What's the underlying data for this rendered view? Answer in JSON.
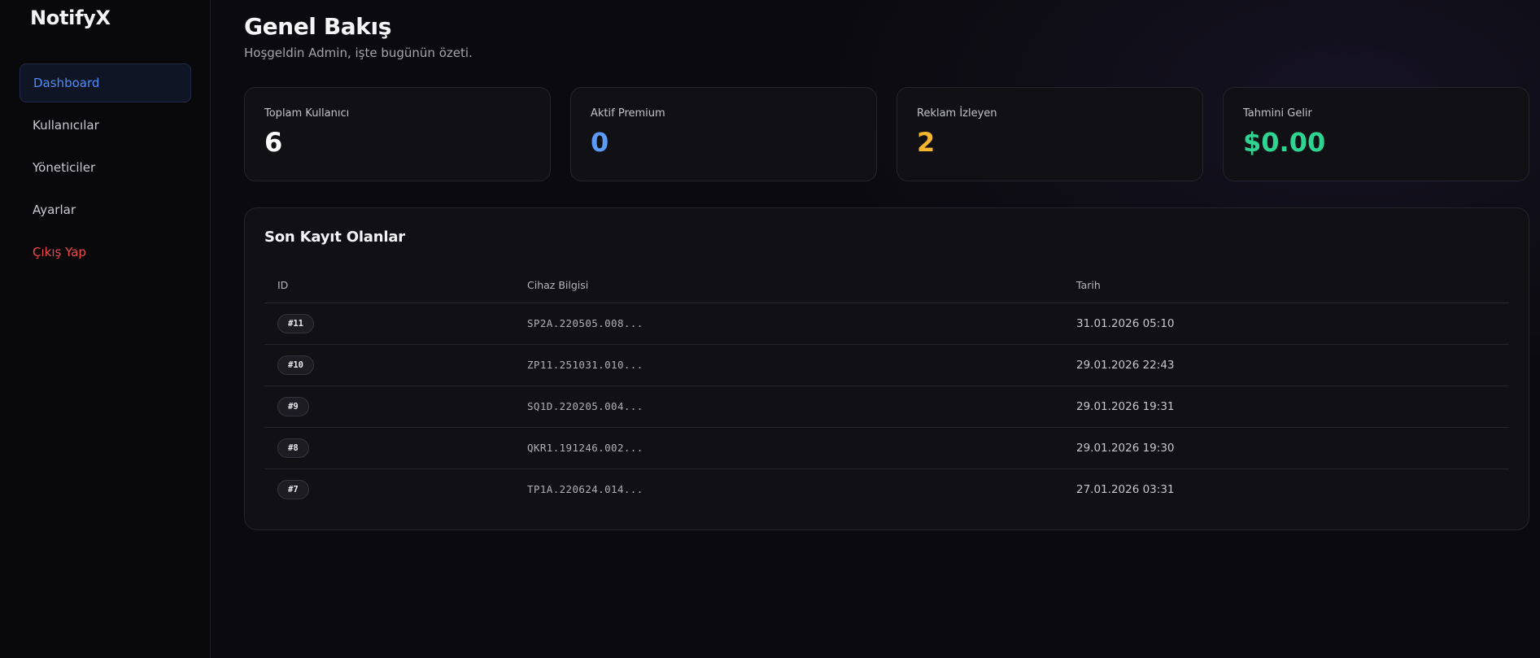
{
  "brand": "NotifyX",
  "nav": {
    "items": [
      {
        "label": "Dashboard"
      },
      {
        "label": "Kullanıcılar"
      },
      {
        "label": "Yöneticiler"
      },
      {
        "label": "Ayarlar"
      },
      {
        "label": "Çıkış Yap"
      }
    ]
  },
  "header": {
    "title": "Genel Bakış",
    "subtitle": "Hoşgeldin Admin, işte bugünün özeti."
  },
  "stats": [
    {
      "label": "Toplam Kullanıcı",
      "value": "6",
      "color": "#ffffff"
    },
    {
      "label": "Aktif Premium",
      "value": "0",
      "color": "#5b9bf8"
    },
    {
      "label": "Reklam İzleyen",
      "value": "2",
      "color": "#f5b52e"
    },
    {
      "label": "Tahmini Gelir",
      "value": "$0.00",
      "color": "#2ed592"
    }
  ],
  "recent": {
    "title": "Son Kayıt Olanlar",
    "columns": [
      "ID",
      "Cihaz Bilgisi",
      "Tarih"
    ],
    "rows": [
      {
        "id": "#11",
        "device": "SP2A.220505.008...",
        "date": "31.01.2026 05:10"
      },
      {
        "id": "#10",
        "device": "ZP11.251031.010...",
        "date": "29.01.2026 22:43"
      },
      {
        "id": "#9",
        "device": "SQ1D.220205.004...",
        "date": "29.01.2026 19:31"
      },
      {
        "id": "#8",
        "device": "QKR1.191246.002...",
        "date": "29.01.2026 19:30"
      },
      {
        "id": "#7",
        "device": "TP1A.220624.014...",
        "date": "27.01.2026 03:31"
      }
    ]
  }
}
